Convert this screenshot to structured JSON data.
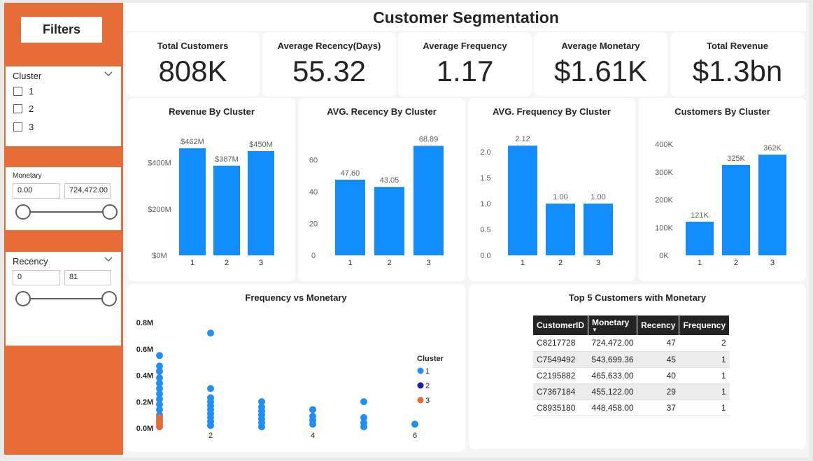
{
  "title": "Customer Segmentation",
  "sidebar": {
    "filters_label": "Filters",
    "cluster": {
      "title": "Cluster",
      "options": [
        "1",
        "2",
        "3"
      ]
    },
    "monetary": {
      "title": "Monetary",
      "min": "0.00",
      "max": "724,472.00"
    },
    "recency": {
      "title": "Recency",
      "min": "0",
      "max": "81"
    }
  },
  "kpis": [
    {
      "label": "Total Customers",
      "value": "808K"
    },
    {
      "label": "Average Recency(Days)",
      "value": "55.32"
    },
    {
      "label": "Average Frequency",
      "value": "1.17"
    },
    {
      "label": "Average Monetary",
      "value": "$1.61K"
    },
    {
      "label": "Total Revenue",
      "value": "$1.3bn"
    }
  ],
  "colors": {
    "accent": "#e66d38",
    "bar": "#118dff",
    "cluster1": "#1f8ff5",
    "cluster2": "#12239e",
    "cluster3": "#e66c37"
  },
  "chart_data": [
    {
      "type": "bar",
      "title": "Revenue By Cluster",
      "categories": [
        "1",
        "2",
        "3"
      ],
      "values": [
        462,
        387,
        450
      ],
      "value_labels": [
        "$462M",
        "$387M",
        "$450M"
      ],
      "ylim": [
        0,
        480
      ],
      "yticks": [
        0,
        200,
        400
      ],
      "ytick_labels": [
        "$0M",
        "$200M",
        "$400M"
      ]
    },
    {
      "type": "bar",
      "title": "AVG. Recency By Cluster",
      "categories": [
        "1",
        "2",
        "3"
      ],
      "values": [
        47.6,
        43.05,
        68.89
      ],
      "value_labels": [
        "47.60",
        "43.05",
        "68.89"
      ],
      "ylim": [
        0,
        70
      ],
      "yticks": [
        0,
        20,
        40,
        60
      ],
      "ytick_labels": [
        "0",
        "20",
        "40",
        "60"
      ]
    },
    {
      "type": "bar",
      "title": "AVG. Frequency By Cluster",
      "categories": [
        "1",
        "2",
        "3"
      ],
      "values": [
        2.12,
        1.0,
        1.0
      ],
      "value_labels": [
        "2.12",
        "1.00",
        "1.00"
      ],
      "ylim": [
        0,
        2.15
      ],
      "yticks": [
        0,
        0.5,
        1.0,
        1.5,
        2.0
      ],
      "ytick_labels": [
        "0.0",
        "0.5",
        "1.0",
        "1.5",
        "2.0"
      ]
    },
    {
      "type": "bar",
      "title": "Customers By Cluster",
      "categories": [
        "1",
        "2",
        "3"
      ],
      "values": [
        121,
        325,
        362
      ],
      "value_labels": [
        "121K",
        "325K",
        "362K"
      ],
      "ylim": [
        0,
        400
      ],
      "yticks": [
        0,
        100,
        200,
        300,
        400
      ],
      "ytick_labels": [
        "0K",
        "100K",
        "200K",
        "300K",
        "400K"
      ]
    },
    {
      "type": "scatter",
      "title": "Frequency vs Monetary",
      "xlim": [
        1,
        6
      ],
      "ylim": [
        0,
        0.8
      ],
      "xticks": [
        2,
        4,
        6
      ],
      "xtick_labels": [
        "2",
        "4",
        "6"
      ],
      "yticks": [
        0,
        0.2,
        0.4,
        0.6,
        0.8
      ],
      "ytick_labels": [
        "0.0M",
        "0.2M",
        "0.4M",
        "0.6M",
        "0.8M"
      ],
      "legend_title": "Cluster",
      "legend_position": "right",
      "series": [
        {
          "name": "1",
          "color": "#1f8ff5",
          "points": [
            [
              1,
              0.55
            ],
            [
              1,
              0.47
            ],
            [
              1,
              0.43
            ],
            [
              1,
              0.38
            ],
            [
              1,
              0.34
            ],
            [
              1,
              0.3
            ],
            [
              1,
              0.26
            ],
            [
              1,
              0.22
            ],
            [
              1,
              0.18
            ],
            [
              1,
              0.14
            ],
            [
              1,
              0.1
            ],
            [
              1,
              0.06
            ],
            [
              2,
              0.72
            ],
            [
              2,
              0.3
            ],
            [
              2,
              0.23
            ],
            [
              2,
              0.2
            ],
            [
              2,
              0.17
            ],
            [
              2,
              0.14
            ],
            [
              2,
              0.11
            ],
            [
              2,
              0.08
            ],
            [
              2,
              0.05
            ],
            [
              2,
              0.02
            ],
            [
              3,
              0.2
            ],
            [
              3,
              0.16
            ],
            [
              3,
              0.13
            ],
            [
              3,
              0.1
            ],
            [
              3,
              0.07
            ],
            [
              3,
              0.04
            ],
            [
              3,
              0.01
            ],
            [
              4,
              0.14
            ],
            [
              4,
              0.09
            ],
            [
              4,
              0.06
            ],
            [
              4,
              0.03
            ],
            [
              5,
              0.2
            ],
            [
              5,
              0.08
            ],
            [
              5,
              0.04
            ],
            [
              5,
              0.01
            ],
            [
              6,
              0.03
            ]
          ]
        },
        {
          "name": "2",
          "color": "#12239e",
          "points": []
        },
        {
          "name": "3",
          "color": "#e66c37",
          "points": [
            [
              1,
              0.08
            ],
            [
              1,
              0.05
            ],
            [
              1,
              0.03
            ],
            [
              1,
              0.01
            ]
          ]
        }
      ]
    },
    {
      "type": "table",
      "title": "Top 5 Customers with Monetary",
      "columns": [
        "CustomerID",
        "Monetary",
        "Recency",
        "Frequency"
      ],
      "rows": [
        [
          "C8217728",
          "724,472.00",
          "47",
          "2"
        ],
        [
          "C7549492",
          "543,699.36",
          "45",
          "1"
        ],
        [
          "C2195882",
          "465,633.00",
          "40",
          "1"
        ],
        [
          "C7367184",
          "455,122.00",
          "29",
          "1"
        ],
        [
          "C8935180",
          "448,458.00",
          "37",
          "1"
        ]
      ]
    }
  ]
}
